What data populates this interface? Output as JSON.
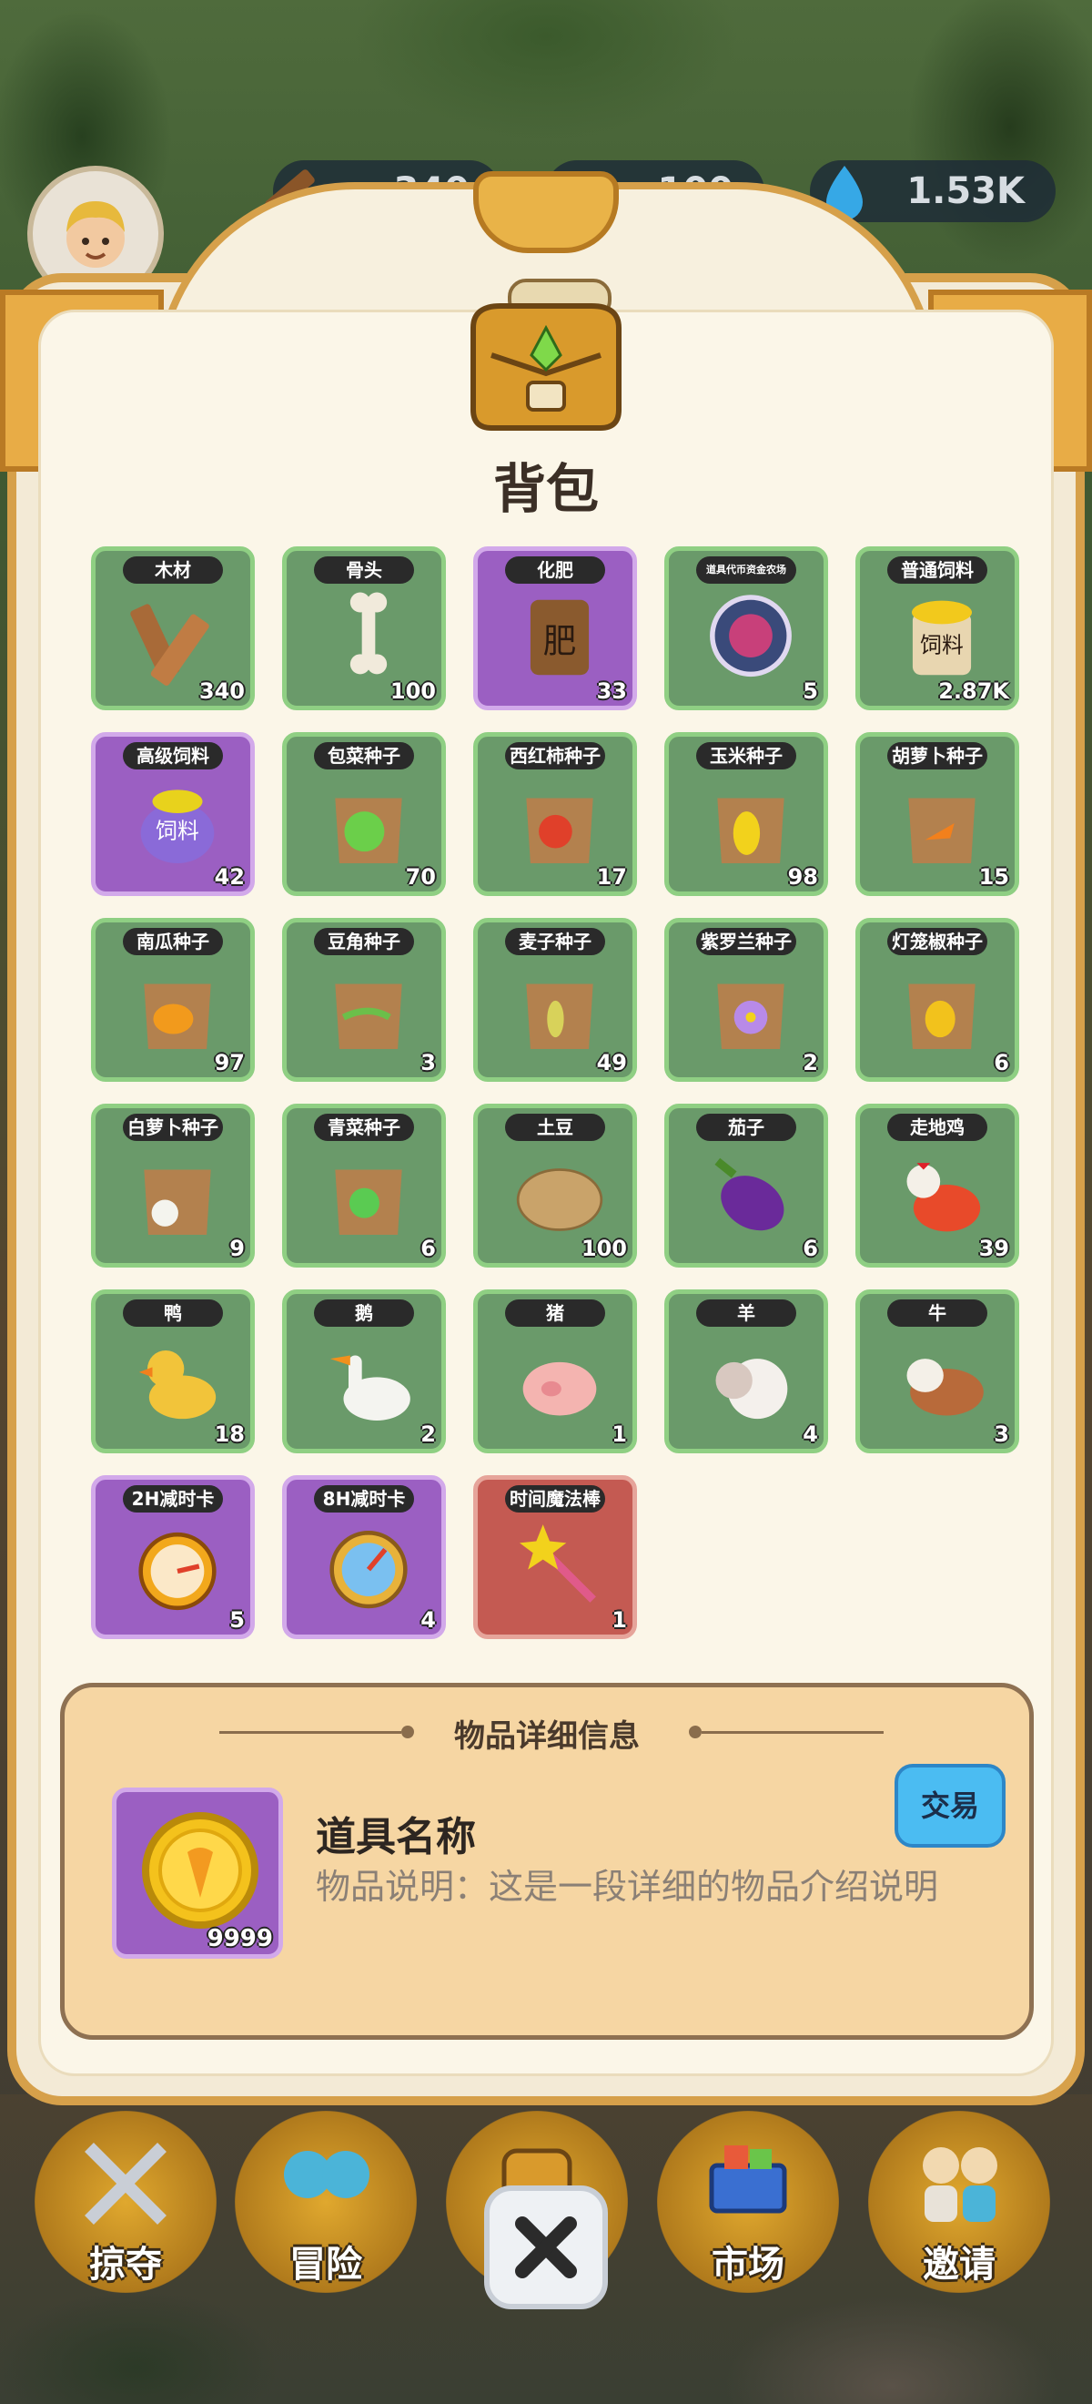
{
  "hud": {
    "wood": "340",
    "bone": "100",
    "water": "1.53K"
  },
  "title": "背包",
  "items": [
    {
      "label": "木材",
      "count": "340",
      "bg": "green",
      "icon": "wood-planks-icon"
    },
    {
      "label": "骨头",
      "count": "100",
      "bg": "green",
      "icon": "bone-icon"
    },
    {
      "label": "化肥",
      "count": "33",
      "bg": "purple",
      "icon": "fertilizer-bag-icon",
      "bag_text": "肥"
    },
    {
      "label": "道具代币资金农场",
      "count": "5",
      "bg": "green",
      "icon": "token-chip-icon"
    },
    {
      "label": "普通饲料",
      "count": "2.87K",
      "bg": "green",
      "icon": "feed-bag-icon",
      "bag_text": "饲料"
    },
    {
      "label": "高级饲料",
      "count": "42",
      "bg": "purple",
      "icon": "premium-feed-bag-icon",
      "bag_text": "饲料"
    },
    {
      "label": "包菜种子",
      "count": "70",
      "bg": "green",
      "icon": "cabbage-seed-icon"
    },
    {
      "label": "西红柿种子",
      "count": "17",
      "bg": "green",
      "icon": "tomato-seed-icon"
    },
    {
      "label": "玉米种子",
      "count": "98",
      "bg": "green",
      "icon": "corn-seed-icon"
    },
    {
      "label": "胡萝卜种子",
      "count": "15",
      "bg": "green",
      "icon": "carrot-seed-icon"
    },
    {
      "label": "南瓜种子",
      "count": "97",
      "bg": "green",
      "icon": "pumpkin-seed-icon"
    },
    {
      "label": "豆角种子",
      "count": "3",
      "bg": "green",
      "icon": "bean-seed-icon"
    },
    {
      "label": "麦子种子",
      "count": "49",
      "bg": "green",
      "icon": "wheat-seed-icon"
    },
    {
      "label": "紫罗兰种子",
      "count": "2",
      "bg": "green",
      "icon": "violet-seed-icon"
    },
    {
      "label": "灯笼椒种子",
      "count": "6",
      "bg": "green",
      "icon": "pepper-seed-icon"
    },
    {
      "label": "白萝卜种子",
      "count": "9",
      "bg": "green",
      "icon": "radish-seed-icon"
    },
    {
      "label": "青菜种子",
      "count": "6",
      "bg": "green",
      "icon": "greens-seed-icon"
    },
    {
      "label": "土豆",
      "count": "100",
      "bg": "green",
      "icon": "potato-icon"
    },
    {
      "label": "茄子",
      "count": "6",
      "bg": "green",
      "icon": "eggplant-icon"
    },
    {
      "label": "走地鸡",
      "count": "39",
      "bg": "green",
      "icon": "chicken-icon"
    },
    {
      "label": "鸭",
      "count": "18",
      "bg": "green",
      "icon": "duck-icon"
    },
    {
      "label": "鹅",
      "count": "2",
      "bg": "green",
      "icon": "goose-icon"
    },
    {
      "label": "猪",
      "count": "1",
      "bg": "green",
      "icon": "pig-icon"
    },
    {
      "label": "羊",
      "count": "4",
      "bg": "green",
      "icon": "sheep-icon"
    },
    {
      "label": "牛",
      "count": "3",
      "bg": "green",
      "icon": "cow-icon"
    },
    {
      "label": "2H减时卡",
      "count": "5",
      "bg": "purple",
      "icon": "stopwatch-icon"
    },
    {
      "label": "8H减时卡",
      "count": "4",
      "bg": "purple",
      "icon": "compass-clock-icon"
    },
    {
      "label": "时间魔法棒",
      "count": "1",
      "bg": "red",
      "icon": "magic-wand-icon"
    }
  ],
  "detail": {
    "header": "物品详细信息",
    "name": "道具名称",
    "description": "物品说明：这是一段详细的物品介绍说明",
    "count": "9999",
    "icon": "gold-coin-icon",
    "trade_label": "交易"
  },
  "nav": [
    {
      "label": "掠夺",
      "icon": "crossed-swords-icon"
    },
    {
      "label": "冒险",
      "icon": "adventurers-icon"
    },
    {
      "label": "",
      "icon": "backpack-nav-icon"
    },
    {
      "label": "市场",
      "icon": "shopping-cart-icon"
    },
    {
      "label": "邀请",
      "icon": "invite-people-icon"
    }
  ],
  "colors": {
    "panel_border": "#d6a04a",
    "slot_green": "#6a9a6a",
    "slot_purple": "#9b5fc2",
    "slot_red": "#c45a52",
    "trade_button": "#4bbcf2"
  }
}
